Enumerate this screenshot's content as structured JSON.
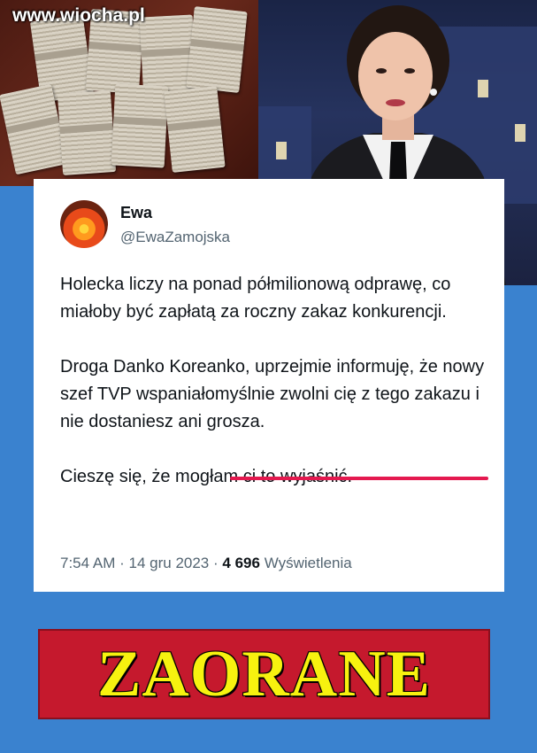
{
  "watermark": "www.wiocha.pl",
  "tweet": {
    "display_name": "Ewa",
    "handle": "@EwaZamojska",
    "paragraphs": [
      "Holecka liczy na ponad półmilionową odprawę, co  miałoby być zapłatą za roczny zakaz konkurencji.",
      "Droga Danko Koreanko, uprzejmie informuję, że nowy szef TVP wspaniałomyślnie zwolni cię z tego zakazu i nie dostaniesz ani grosza.",
      "Cieszę się, że mogłam ci to wyjaśnić."
    ],
    "time": "7:54 AM",
    "separator": "·",
    "date": "14 gru 2023",
    "views_count": "4 696",
    "views_label": "Wyświetlenia"
  },
  "banner": {
    "text": "ZAORANE"
  },
  "colors": {
    "background": "#3a82cf",
    "underline": "#e4194f",
    "banner_bg": "#c5192d",
    "banner_text": "#f7f20f"
  },
  "images": {
    "money_photo": "stacks-of-banknotes-photo",
    "presenter_photo": "tv-presenter-photo",
    "avatar": "sunset-avatar-icon"
  }
}
